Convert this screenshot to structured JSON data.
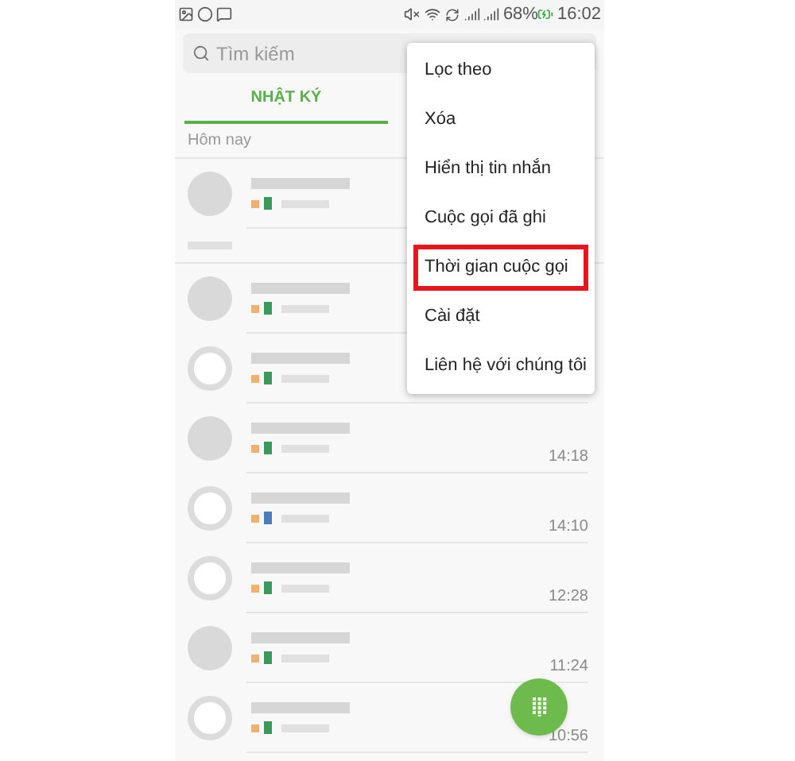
{
  "status_bar": {
    "battery": "68%",
    "time": "16:02"
  },
  "search": {
    "placeholder": "Tìm kiếm"
  },
  "tabs": [
    {
      "label": "NHẬT KÝ",
      "selected": true
    }
  ],
  "groups": [
    {
      "header": "Hôm nay",
      "calls": [
        {
          "color": "#3a9a5b",
          "hollow": false
        }
      ]
    },
    {
      "calls": [
        {
          "color": "#3a9a5b",
          "hollow": false
        },
        {
          "color": "#3a9a5b",
          "hollow": true
        },
        {
          "color": "#3a9a5b",
          "hollow": false,
          "time": "14:18"
        },
        {
          "color": "#4a7ec0",
          "hollow": true,
          "time": "14:10"
        },
        {
          "color": "#3a9a5b",
          "hollow": true,
          "time": "12:28"
        },
        {
          "color": "#3a9a5b",
          "hollow": false,
          "time": "11:24"
        },
        {
          "color": "#3a9a5b",
          "hollow": true,
          "time": "10:56"
        }
      ]
    }
  ],
  "menu": [
    {
      "label": "Lọc theo",
      "highlighted": false
    },
    {
      "label": "Xóa",
      "highlighted": false
    },
    {
      "label": "Hiển thị tin nhắn",
      "highlighted": false
    },
    {
      "label": "Cuộc gọi đã ghi",
      "highlighted": false
    },
    {
      "label": "Thời gian cuộc gọi",
      "highlighted": true
    },
    {
      "label": "Cài đặt",
      "highlighted": false
    },
    {
      "label": "Liên hệ với chúng tôi",
      "highlighted": false
    }
  ]
}
